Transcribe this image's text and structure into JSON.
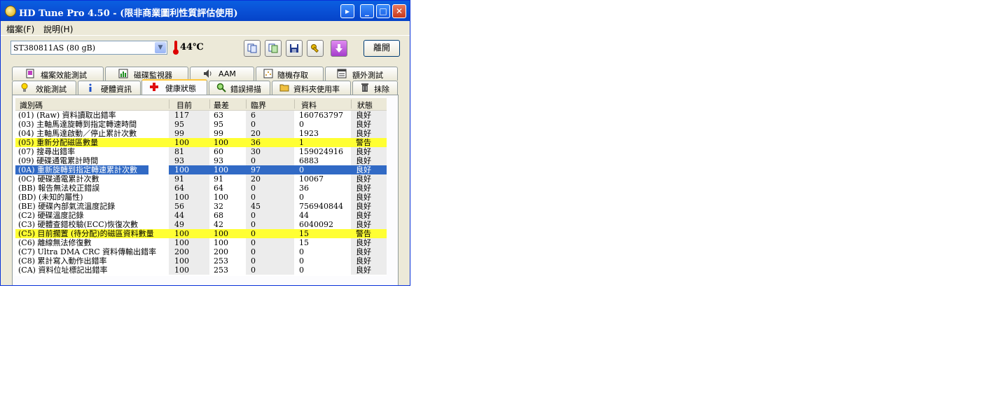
{
  "window": {
    "title": "HD Tune Pro 4.50 - (限非商業圖利性質評估使用)"
  },
  "menu": [
    "檔案(F)",
    "說明(H)"
  ],
  "toolbar": {
    "drive": "ST380811AS (80 gB)",
    "temperature": "44℃",
    "exit_label": "離開"
  },
  "tabs_top": [
    "檔案效能測試",
    "磁碟監視器",
    "AAM",
    "隨機存取",
    "額外測試"
  ],
  "tabs_bottom": [
    "效能測試",
    "硬體資訊",
    "健康狀態",
    "錯誤掃描",
    "資料夾使用率",
    "抹除"
  ],
  "active_tab": "健康狀態",
  "columns": [
    "識別碼",
    "目前",
    "最差",
    "臨界",
    "資料",
    "狀態"
  ],
  "rows": [
    {
      "id": "(01) (Raw) 資料讀取出錯率",
      "current": "117",
      "worst": "63",
      "threshold": "6",
      "data": "160763797",
      "status": "良好",
      "style": "normal"
    },
    {
      "id": "(03) 主軸馬達旋轉到指定轉速時間",
      "current": "95",
      "worst": "95",
      "threshold": "0",
      "data": "0",
      "status": "良好",
      "style": "normal"
    },
    {
      "id": "(04) 主軸馬達啟動／停止累計次數",
      "current": "99",
      "worst": "99",
      "threshold": "20",
      "data": "1923",
      "status": "良好",
      "style": "normal"
    },
    {
      "id": "(05) 重新分配磁區數量",
      "current": "100",
      "worst": "100",
      "threshold": "36",
      "data": "1",
      "status": "警告",
      "style": "warning"
    },
    {
      "id": "(07) 搜尋出錯率",
      "current": "81",
      "worst": "60",
      "threshold": "30",
      "data": "159024916",
      "status": "良好",
      "style": "normal"
    },
    {
      "id": "(09) 硬碟通電累計時間",
      "current": "93",
      "worst": "93",
      "threshold": "0",
      "data": "6883",
      "status": "良好",
      "style": "normal"
    },
    {
      "id": "(0A) 重新旋轉到指定轉速累計次數",
      "current": "100",
      "worst": "100",
      "threshold": "97",
      "data": "0",
      "status": "良好",
      "style": "selected"
    },
    {
      "id": "(0C) 硬碟通電累計次數",
      "current": "91",
      "worst": "91",
      "threshold": "20",
      "data": "10067",
      "status": "良好",
      "style": "normal"
    },
    {
      "id": "(BB) 報告無法校正錯誤",
      "current": "64",
      "worst": "64",
      "threshold": "0",
      "data": "36",
      "status": "良好",
      "style": "normal"
    },
    {
      "id": "(BD) (未知的屬性)",
      "current": "100",
      "worst": "100",
      "threshold": "0",
      "data": "0",
      "status": "良好",
      "style": "normal"
    },
    {
      "id": "(BE) 硬碟內部氣流溫度記錄",
      "current": "56",
      "worst": "32",
      "threshold": "45",
      "data": "756940844",
      "status": "良好",
      "style": "normal"
    },
    {
      "id": "(C2) 硬碟溫度記錄",
      "current": "44",
      "worst": "68",
      "threshold": "0",
      "data": "44",
      "status": "良好",
      "style": "normal"
    },
    {
      "id": "(C3) 硬體查錯校驗(ECC)恢復次數",
      "current": "49",
      "worst": "42",
      "threshold": "0",
      "data": "6040092",
      "status": "良好",
      "style": "normal"
    },
    {
      "id": "(C5) 目前擱置 (待分配)的磁區資料數量",
      "current": "100",
      "worst": "100",
      "threshold": "0",
      "data": "15",
      "status": "警告",
      "style": "warning"
    },
    {
      "id": "(C6) 離線無法修復數",
      "current": "100",
      "worst": "100",
      "threshold": "0",
      "data": "15",
      "status": "良好",
      "style": "normal"
    },
    {
      "id": "(C7) Ultra DMA CRC 資料傳輸出錯率",
      "current": "200",
      "worst": "200",
      "threshold": "0",
      "data": "0",
      "status": "良好",
      "style": "normal"
    },
    {
      "id": "(C8) 累計寫入動作出錯率",
      "current": "100",
      "worst": "253",
      "threshold": "0",
      "data": "0",
      "status": "良好",
      "style": "normal"
    },
    {
      "id": "(CA) 資料位址標記出錯率",
      "current": "100",
      "worst": "253",
      "threshold": "0",
      "data": "0",
      "status": "良好",
      "style": "normal"
    }
  ],
  "colors": {
    "warning_bg": "#ffff33",
    "selected_bg": "#316ac5",
    "title_blue": "#0a53d8"
  }
}
